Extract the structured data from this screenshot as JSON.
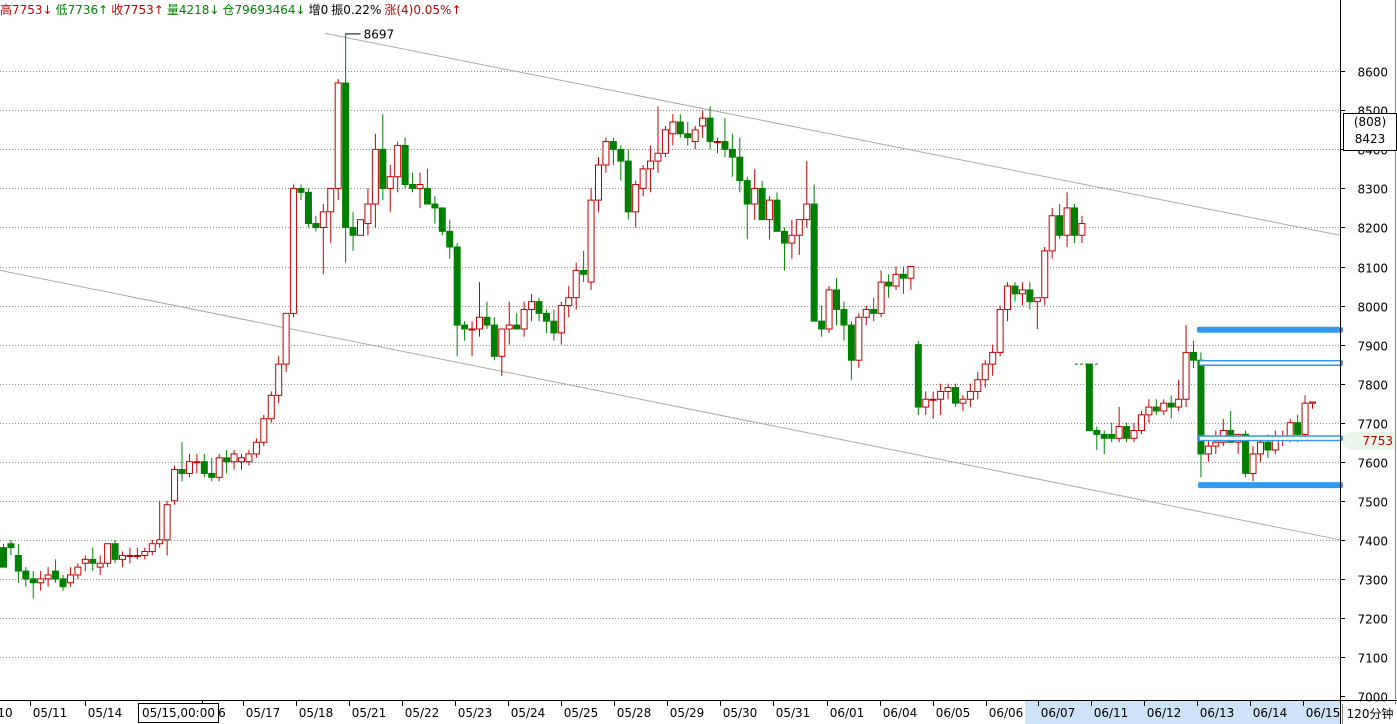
{
  "info_bar": [
    {
      "label": "高7753↓",
      "dir": "up"
    },
    {
      "label": "低7736↑",
      "dir": "down"
    },
    {
      "label": "收7753↑",
      "dir": "up"
    },
    {
      "label": "量4218↓",
      "dir": "down"
    },
    {
      "label": "仓79693464↓",
      "dir": "down"
    },
    {
      "label": "增0",
      "dir": "neutral"
    },
    {
      "label": "振0.22%",
      "dir": "neutral"
    },
    {
      "label": "涨(4)0.05%↑",
      "dir": "up"
    }
  ],
  "period_label": "120分钟",
  "cursor_date": "05/15,00:00",
  "price_tag": {
    "range": "(808)",
    "level": "8423"
  },
  "last_price": "7753",
  "peak_label": "8697",
  "colors": {
    "up": "#c00000",
    "down": "#008000",
    "grid": "#888888",
    "zone": "#3399ee",
    "highlight": "#cde3f7"
  },
  "chart_data": {
    "type": "candlestick",
    "title": "",
    "xlabel": "",
    "ylabel": "",
    "ylim": [
      7000,
      8700
    ],
    "yticks": [
      7000,
      7100,
      7200,
      7300,
      7400,
      7500,
      7600,
      7700,
      7800,
      7900,
      8000,
      8100,
      8200,
      8300,
      8400,
      8500,
      8600
    ],
    "x_tick_labels": [
      "10",
      "05/11",
      "05/14",
      "6",
      "05/17",
      "05/18",
      "05/21",
      "05/22",
      "05/23",
      "05/24",
      "05/25",
      "05/28",
      "05/29",
      "05/30",
      "05/31",
      "06/01",
      "06/04",
      "06/05",
      "06/06",
      "06/07",
      "06/11",
      "06/12",
      "06/13",
      "06/14",
      "06/15"
    ],
    "highlighted_x_range": [
      "06/07",
      "06/15"
    ],
    "candles": [
      [
        7380,
        7390,
        7340,
        7330
      ],
      [
        7390,
        7400,
        7360,
        7380
      ],
      [
        7360,
        7390,
        7290,
        7320
      ],
      [
        7320,
        7330,
        7280,
        7300
      ],
      [
        7300,
        7320,
        7250,
        7290
      ],
      [
        7290,
        7320,
        7270,
        7300
      ],
      [
        7300,
        7330,
        7280,
        7310
      ],
      [
        7320,
        7350,
        7290,
        7300
      ],
      [
        7300,
        7310,
        7270,
        7280
      ],
      [
        7290,
        7330,
        7280,
        7310
      ],
      [
        7310,
        7340,
        7300,
        7330
      ],
      [
        7340,
        7360,
        7320,
        7350
      ],
      [
        7350,
        7380,
        7320,
        7340
      ],
      [
        7330,
        7360,
        7310,
        7340
      ],
      [
        7340,
        7390,
        7330,
        7390
      ],
      [
        7390,
        7400,
        7340,
        7350
      ],
      [
        7350,
        7370,
        7330,
        7360
      ],
      [
        7360,
        7380,
        7340,
        7360
      ],
      [
        7360,
        7380,
        7350,
        7360
      ],
      [
        7360,
        7380,
        7350,
        7370
      ],
      [
        7370,
        7400,
        7360,
        7390
      ],
      [
        7390,
        7500,
        7380,
        7400
      ],
      [
        7400,
        7500,
        7360,
        7490
      ],
      [
        7500,
        7590,
        7490,
        7580
      ],
      [
        7580,
        7650,
        7550,
        7570
      ],
      [
        7570,
        7620,
        7560,
        7600
      ],
      [
        7600,
        7620,
        7570,
        7600
      ],
      [
        7600,
        7620,
        7560,
        7570
      ],
      [
        7570,
        7610,
        7550,
        7560
      ],
      [
        7560,
        7620,
        7550,
        7610
      ],
      [
        7610,
        7630,
        7570,
        7600
      ],
      [
        7600,
        7630,
        7580,
        7620
      ],
      [
        7600,
        7620,
        7580,
        7610
      ],
      [
        7600,
        7630,
        7590,
        7620
      ],
      [
        7620,
        7660,
        7610,
        7650
      ],
      [
        7650,
        7720,
        7640,
        7710
      ],
      [
        7710,
        7780,
        7700,
        7770
      ],
      [
        7770,
        7870,
        7750,
        7850
      ],
      [
        7850,
        7980,
        7830,
        7980
      ],
      [
        7980,
        8310,
        7970,
        8300
      ],
      [
        8300,
        8310,
        8270,
        8290
      ],
      [
        8290,
        8300,
        8200,
        8210
      ],
      [
        8210,
        8230,
        8190,
        8200
      ],
      [
        8200,
        8260,
        8080,
        8240
      ],
      [
        8240,
        8300,
        8160,
        8300
      ],
      [
        8300,
        8580,
        8270,
        8570
      ],
      [
        8570,
        8697,
        8110,
        8200
      ],
      [
        8200,
        8240,
        8140,
        8180
      ],
      [
        8180,
        8220,
        8180,
        8220
      ],
      [
        8210,
        8300,
        8180,
        8260
      ],
      [
        8260,
        8440,
        8200,
        8400
      ],
      [
        8400,
        8490,
        8270,
        8300
      ],
      [
        8300,
        8360,
        8240,
        8330
      ],
      [
        8330,
        8420,
        8290,
        8410
      ],
      [
        8410,
        8430,
        8300,
        8310
      ],
      [
        8310,
        8340,
        8290,
        8300
      ],
      [
        8300,
        8340,
        8250,
        8310
      ],
      [
        8300,
        8350,
        8260,
        8260
      ],
      [
        8260,
        8280,
        8210,
        8250
      ],
      [
        8250,
        8250,
        8180,
        8190
      ],
      [
        8190,
        8220,
        8120,
        8150
      ],
      [
        8150,
        8160,
        7870,
        7950
      ],
      [
        7950,
        7960,
        7910,
        7940
      ],
      [
        7940,
        7960,
        7870,
        7940
      ],
      [
        7940,
        8060,
        7920,
        7970
      ],
      [
        7970,
        8010,
        7940,
        7950
      ],
      [
        7950,
        7970,
        7860,
        7870
      ],
      [
        7870,
        7940,
        7820,
        7940
      ],
      [
        7940,
        8010,
        7900,
        7950
      ],
      [
        7950,
        7980,
        7940,
        7940
      ],
      [
        7940,
        8010,
        7920,
        7990
      ],
      [
        7990,
        8030,
        7960,
        8010
      ],
      [
        8010,
        8020,
        7960,
        7980
      ],
      [
        7980,
        7990,
        7930,
        7960
      ],
      [
        7960,
        7990,
        7910,
        7930
      ],
      [
        7930,
        8010,
        7900,
        8000
      ],
      [
        8000,
        8050,
        7970,
        8020
      ],
      [
        8020,
        8110,
        7990,
        8090
      ],
      [
        8090,
        8140,
        8060,
        8080
      ],
      [
        8060,
        8300,
        8040,
        8270
      ],
      [
        8270,
        8380,
        8240,
        8360
      ],
      [
        8360,
        8430,
        8340,
        8420
      ],
      [
        8420,
        8430,
        8360,
        8400
      ],
      [
        8400,
        8410,
        8320,
        8370
      ],
      [
        8370,
        8400,
        8220,
        8240
      ],
      [
        8240,
        8320,
        8200,
        8310
      ],
      [
        8300,
        8360,
        8280,
        8350
      ],
      [
        8350,
        8410,
        8290,
        8370
      ],
      [
        8370,
        8510,
        8340,
        8390
      ],
      [
        8390,
        8460,
        8380,
        8450
      ],
      [
        8440,
        8490,
        8410,
        8470
      ],
      [
        8470,
        8490,
        8430,
        8440
      ],
      [
        8440,
        8470,
        8410,
        8430
      ],
      [
        8420,
        8460,
        8400,
        8450
      ],
      [
        8460,
        8500,
        8430,
        8480
      ],
      [
        8480,
        8510,
        8400,
        8420
      ],
      [
        8420,
        8430,
        8390,
        8420
      ],
      [
        8420,
        8480,
        8380,
        8400
      ],
      [
        8400,
        8440,
        8330,
        8380
      ],
      [
        8380,
        8430,
        8290,
        8320
      ],
      [
        8320,
        8330,
        8170,
        8260
      ],
      [
        8260,
        8350,
        8220,
        8300
      ],
      [
        8300,
        8320,
        8230,
        8220
      ],
      [
        8220,
        8280,
        8170,
        8270
      ],
      [
        8270,
        8290,
        8200,
        8190
      ],
      [
        8190,
        8200,
        8090,
        8160
      ],
      [
        8160,
        8220,
        8120,
        8180
      ],
      [
        8180,
        8200,
        8130,
        8220
      ],
      [
        8220,
        8370,
        8200,
        8260
      ],
      [
        8260,
        8310,
        7960,
        7960
      ],
      [
        7960,
        8000,
        7920,
        7940
      ],
      [
        7940,
        8050,
        7930,
        8040
      ],
      [
        8040,
        8070,
        7950,
        7990
      ],
      [
        7990,
        8010,
        7910,
        7950
      ],
      [
        7950,
        7960,
        7810,
        7860
      ],
      [
        7860,
        7980,
        7840,
        7970
      ],
      [
        7970,
        8000,
        7950,
        7990
      ],
      [
        7990,
        8020,
        7960,
        7980
      ],
      [
        7980,
        8090,
        7970,
        8060
      ],
      [
        8060,
        8080,
        8020,
        8050
      ],
      [
        8050,
        8100,
        8040,
        8080
      ],
      [
        8080,
        8100,
        8030,
        8070
      ],
      [
        8070,
        8080,
        8040,
        8100
      ],
      [
        7900,
        7910,
        7720,
        7740
      ],
      [
        7740,
        7780,
        7720,
        7760
      ],
      [
        7760,
        7780,
        7710,
        7760
      ],
      [
        7760,
        7800,
        7720,
        7780
      ],
      [
        7780,
        7800,
        7760,
        7790
      ],
      [
        7790,
        7800,
        7740,
        7750
      ],
      [
        7750,
        7770,
        7730,
        7760
      ],
      [
        7760,
        7800,
        7740,
        7780
      ],
      [
        7780,
        7830,
        7760,
        7810
      ],
      [
        7810,
        7860,
        7790,
        7850
      ],
      [
        7850,
        7900,
        7820,
        7880
      ],
      [
        7880,
        8000,
        7870,
        7990
      ],
      [
        7990,
        8060,
        7960,
        8050
      ],
      [
        8050,
        8060,
        8010,
        8030
      ],
      [
        8030,
        8060,
        8000,
        8040
      ],
      [
        8040,
        8060,
        7990,
        8010
      ],
      [
        8010,
        8020,
        7940,
        8020
      ],
      [
        8020,
        8150,
        8000,
        8140
      ],
      [
        8140,
        8250,
        8120,
        8230
      ],
      [
        8230,
        8260,
        8170,
        8180
      ],
      [
        8180,
        8290,
        8150,
        8250
      ],
      [
        8250,
        8260,
        8160,
        8180
      ],
      [
        8180,
        8230,
        8160,
        8210
      ],
      [
        7850,
        7850,
        7680,
        7680
      ],
      [
        7680,
        7690,
        7630,
        7670
      ],
      [
        7670,
        7680,
        7620,
        7660
      ],
      [
        7670,
        7700,
        7650,
        7660
      ],
      [
        7660,
        7740,
        7650,
        7690
      ],
      [
        7690,
        7700,
        7650,
        7660
      ],
      [
        7660,
        7700,
        7650,
        7680
      ],
      [
        7680,
        7730,
        7670,
        7720
      ],
      [
        7720,
        7760,
        7700,
        7740
      ],
      [
        7740,
        7760,
        7720,
        7730
      ],
      [
        7730,
        7760,
        7720,
        7750
      ],
      [
        7750,
        7770,
        7710,
        7740
      ],
      [
        7740,
        7810,
        7730,
        7760
      ],
      [
        7760,
        7950,
        7740,
        7880
      ],
      [
        7880,
        7910,
        7840,
        7860
      ],
      [
        7860,
        7880,
        7560,
        7620
      ],
      [
        7620,
        7660,
        7600,
        7640
      ],
      [
        7640,
        7680,
        7620,
        7650
      ],
      [
        7650,
        7710,
        7640,
        7680
      ],
      [
        7680,
        7730,
        7650,
        7650
      ],
      [
        7650,
        7670,
        7620,
        7670
      ],
      [
        7670,
        7680,
        7560,
        7570
      ],
      [
        7570,
        7640,
        7550,
        7620
      ],
      [
        7620,
        7660,
        7600,
        7650
      ],
      [
        7650,
        7670,
        7610,
        7630
      ],
      [
        7630,
        7680,
        7620,
        7660
      ],
      [
        7660,
        7680,
        7640,
        7660
      ],
      [
        7660,
        7710,
        7650,
        7700
      ],
      [
        7700,
        7720,
        7650,
        7670
      ],
      [
        7670,
        7770,
        7660,
        7750
      ],
      [
        7750,
        7753,
        7736,
        7753
      ]
    ],
    "trendlines": [
      {
        "from": [
          "05/18",
          8697
        ],
        "to": [
          "06/15",
          8180
        ]
      },
      {
        "from": [
          "05/10",
          8090
        ],
        "to": [
          "06/15",
          7400
        ]
      }
    ],
    "zones": [
      7938,
      7853,
      7660,
      7540
    ]
  }
}
